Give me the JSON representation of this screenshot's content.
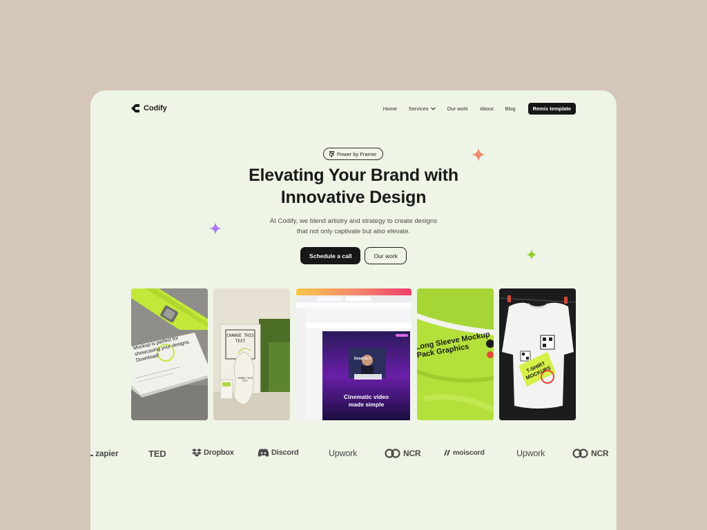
{
  "nav": {
    "logo_text": "Codify",
    "links": [
      "Home",
      "Services",
      "Our work",
      "About",
      "Blog"
    ],
    "cta": "Remix template"
  },
  "hero": {
    "badge": "Power by Framer",
    "title_line1": "Elevating Your Brand with",
    "title_line2": "Innovative Design",
    "subtitle_line1": "At Codify, we blend artistry and strategy to create designs",
    "subtitle_line2": "that not only captivate but also elevate.",
    "primary_cta": "Schedule a call",
    "secondary_cta": "Our work"
  },
  "gallery": {
    "card1_text": "Mockup is perfect for showcasing your designs. Download!",
    "card2_text_top": "CHANGE THIS TEXT",
    "card2_text_bag": "CHANGE THIS TEXT",
    "card3_headline_line1": "Cinematic video",
    "card3_headline_line2": "made simple",
    "card3_overlay": "Detail in 3",
    "card4_text": "Long Sleeve Mockup Pack Graphics",
    "card5_text": "T-SHIRT MOCKUPS"
  },
  "logos": [
    "zapier",
    "TED",
    "Dropbox",
    "Discord",
    "Upwork",
    "NCR",
    "moiscord",
    "Upwork",
    "NCR"
  ],
  "colors": {
    "page_bg": "#d4c7b9",
    "frame_bg": "#eef4e6",
    "accent_lime": "#b4e03c",
    "sparkle_orange": "#f08a6a",
    "sparkle_purple": "#a77af0",
    "sparkle_green": "#8ed02c"
  }
}
